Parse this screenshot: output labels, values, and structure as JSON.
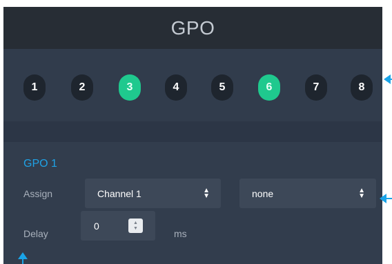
{
  "header": {
    "title": "GPO"
  },
  "channels": {
    "items": [
      {
        "label": "1",
        "active": false
      },
      {
        "label": "2",
        "active": false
      },
      {
        "label": "3",
        "active": true
      },
      {
        "label": "4",
        "active": false
      },
      {
        "label": "5",
        "active": false
      },
      {
        "label": "6",
        "active": true
      },
      {
        "label": "7",
        "active": false
      },
      {
        "label": "8",
        "active": false
      }
    ],
    "active_color": "#1fc98e",
    "inactive_color": "#1e252e"
  },
  "gpo_settings": {
    "title": "GPO 1",
    "assign_label": "Assign",
    "assign_channel_value": "Channel 1",
    "assign_second_value": "none",
    "delay_label": "Delay",
    "delay_value": "0",
    "delay_unit": "ms"
  },
  "colors": {
    "accent": "#1fa2e6",
    "callout": "#1aa4e8"
  }
}
